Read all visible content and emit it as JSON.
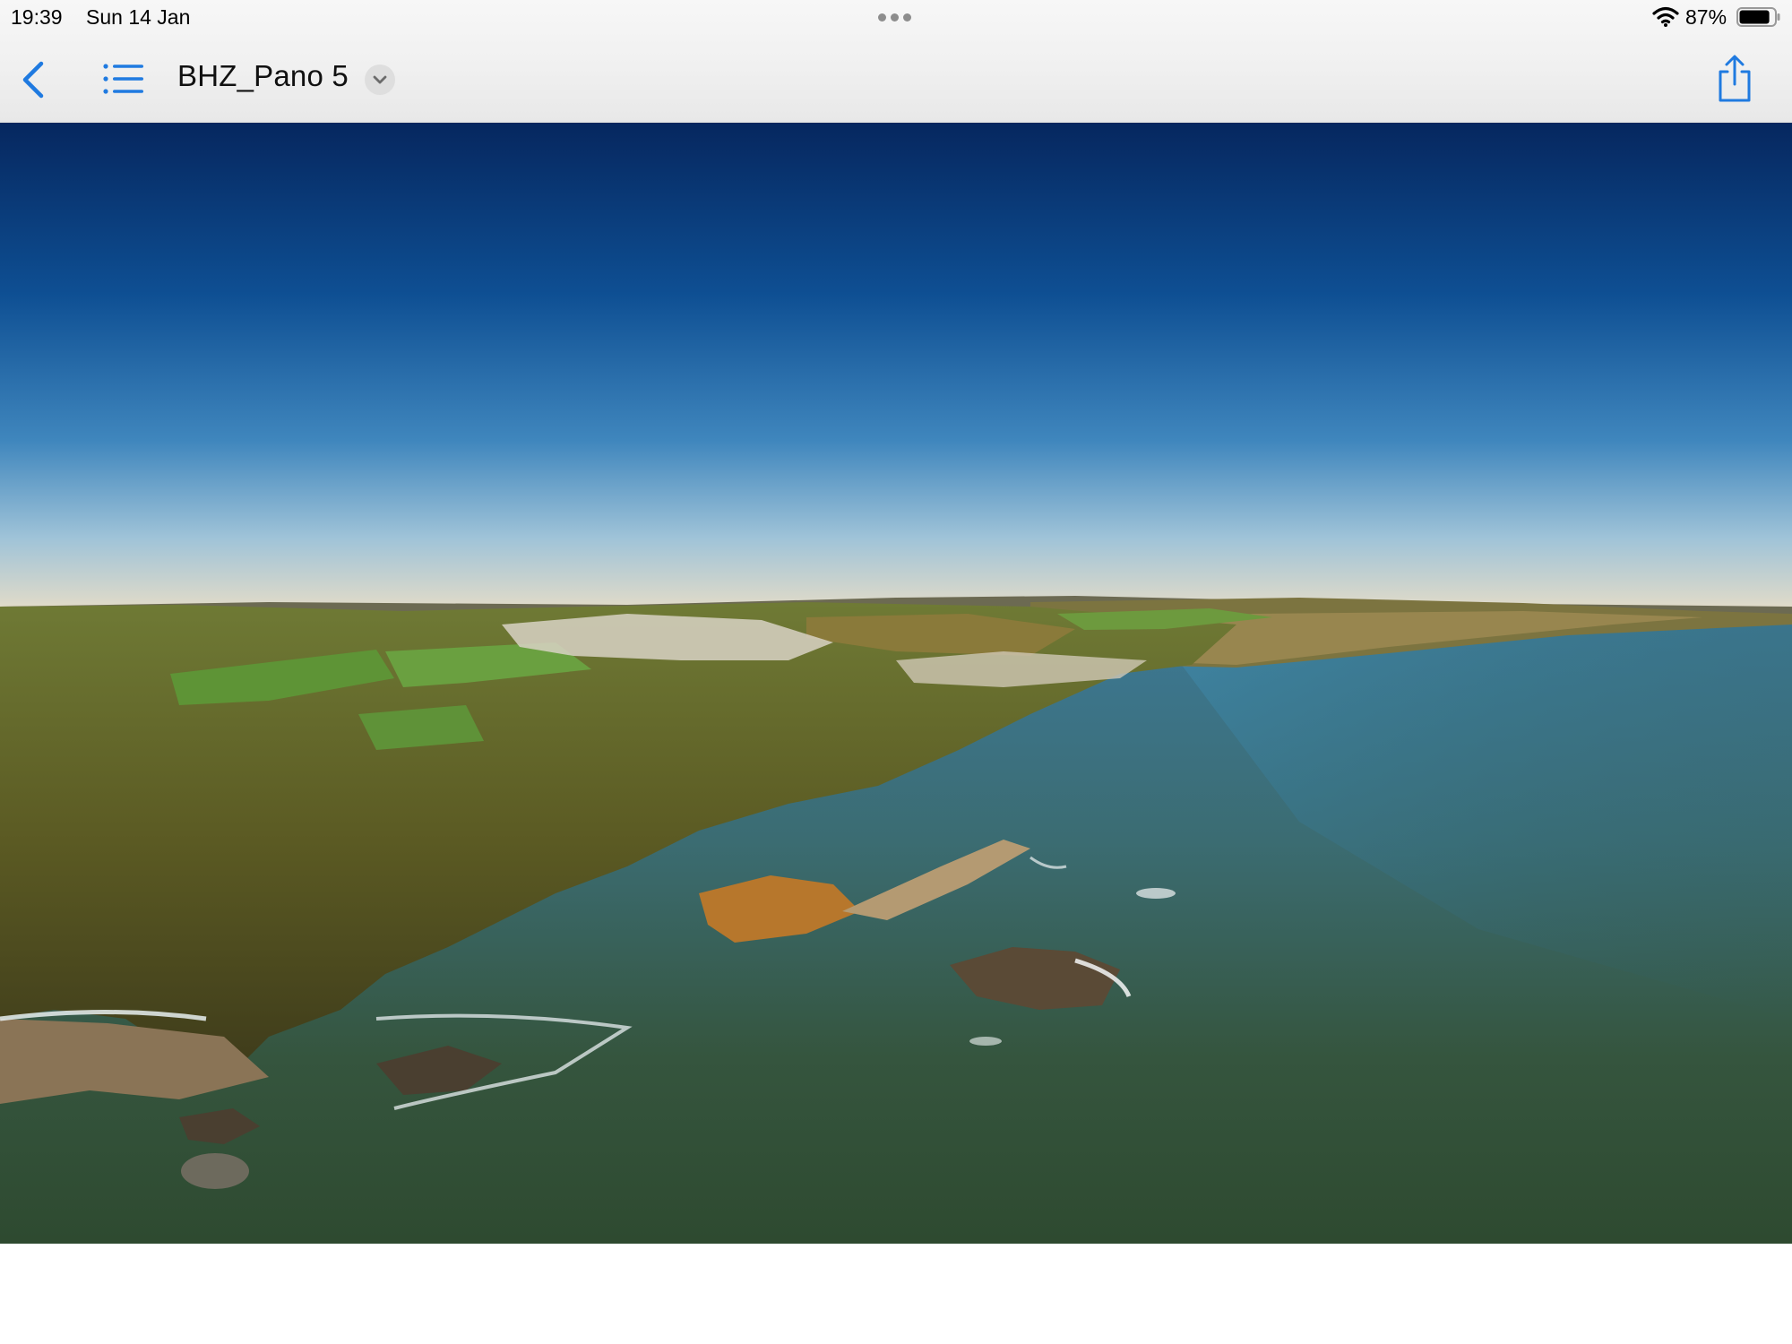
{
  "status_bar": {
    "time": "19:39",
    "date": "Sun 14 Jan",
    "battery_percent": "87%",
    "battery_level": 0.87
  },
  "toolbar": {
    "title": "BHZ_Pano 5",
    "back_icon": "chevron-left-icon",
    "list_icon": "list-icon",
    "title_menu_icon": "chevron-down-icon",
    "share_icon": "share-icon"
  },
  "colors": {
    "accent": "#1f7ae0",
    "toolbar_bg": "#f2f2f2",
    "sky_top": "#0a2a63",
    "sea": "#33503c"
  }
}
